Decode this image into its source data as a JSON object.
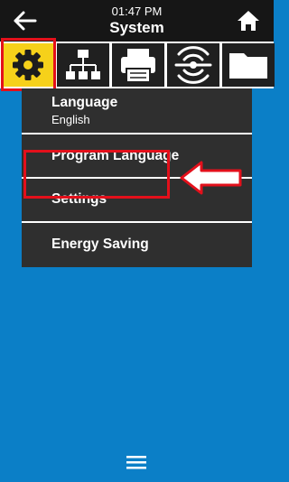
{
  "header": {
    "time": "01:47 PM",
    "title": "System",
    "back_icon": "back-arrow-icon",
    "home_icon": "home-icon"
  },
  "tabs": [
    {
      "icon": "gear-icon",
      "active": true
    },
    {
      "icon": "network-icon",
      "active": false
    },
    {
      "icon": "printer-icon",
      "active": false
    },
    {
      "icon": "sensor-icon",
      "active": false
    },
    {
      "icon": "folder-icon",
      "active": false
    }
  ],
  "menu": {
    "items": [
      {
        "label": "Language",
        "value": "English"
      },
      {
        "label": "Program Language"
      },
      {
        "label": "Settings"
      },
      {
        "label": "Energy Saving"
      }
    ]
  },
  "footer": {
    "menu_icon": "hamburger-menu-icon"
  },
  "colors": {
    "background": "#0b7fc7",
    "header": "#161616",
    "active_tab": "#f6d11a",
    "menu_item": "#2f2f2f",
    "highlight": "#e3101b"
  }
}
